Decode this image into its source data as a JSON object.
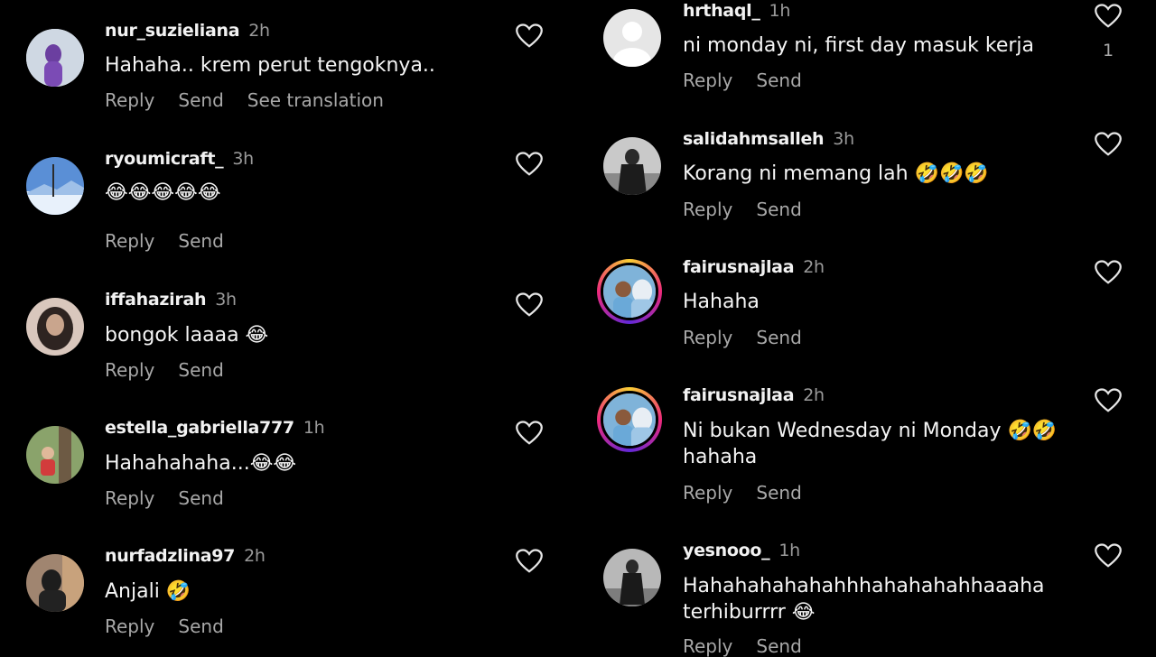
{
  "left": [
    {
      "username": "nur_suzieliana",
      "time": "2h",
      "text": "Hahaha.. krem perut tengoknya..",
      "actions": [
        "Reply",
        "Send",
        "See translation"
      ],
      "avatar_color": "#cfd8e3"
    },
    {
      "username": "ryoumicraft_",
      "time": "3h",
      "text": "😂😂😂😂😂",
      "actions": [
        "Reply",
        "Send"
      ],
      "avatar_color": "#5a8fd6"
    },
    {
      "username": "iffahazirah",
      "time": "3h",
      "text": "bongok laaaa 😂",
      "actions": [
        "Reply",
        "Send"
      ],
      "avatar_color": "#d9c7bd"
    },
    {
      "username": "estella_gabriella777",
      "time": "1h",
      "text": "Hahahahaha...😂😂",
      "actions": [
        "Reply",
        "Send"
      ],
      "avatar_color": "#8aa36b"
    },
    {
      "username": "nurfadzlina97",
      "time": "2h",
      "text": "Anjali 🤣",
      "actions": [
        "Reply",
        "Send"
      ],
      "avatar_color": "#a08570"
    }
  ],
  "right": [
    {
      "username": "hrthaql_",
      "time": "1h",
      "text": "ni monday ni, first day masuk kerja",
      "actions": [
        "Reply",
        "Send"
      ],
      "likes": "1",
      "avatar_color": "#e6e6e6"
    },
    {
      "username": "salidahmsalleh",
      "time": "3h",
      "text": "Korang ni memang lah 🤣🤣🤣",
      "actions": [
        "Reply",
        "Send"
      ],
      "avatar_color": "#c9c9c9"
    },
    {
      "username": "fairusnajlaa",
      "time": "2h",
      "text": "Hahaha",
      "actions": [
        "Reply",
        "Send"
      ],
      "avatar_color": "#7fb3d9"
    },
    {
      "username": "fairusnajlaa",
      "time": "2h",
      "text": "Ni bukan Wednesday ni Monday 🤣🤣",
      "text2": "hahaha",
      "actions": [
        "Reply",
        "Send"
      ],
      "avatar_color": "#7fb3d9"
    },
    {
      "username": "yesnooo_",
      "time": "1h",
      "text": "Hahahahahahahhhahahahahhaaaha",
      "text2": "terhiburrrr 😂",
      "actions": [
        "Reply",
        "Send"
      ],
      "avatar_color": "#b8b8b8"
    }
  ]
}
